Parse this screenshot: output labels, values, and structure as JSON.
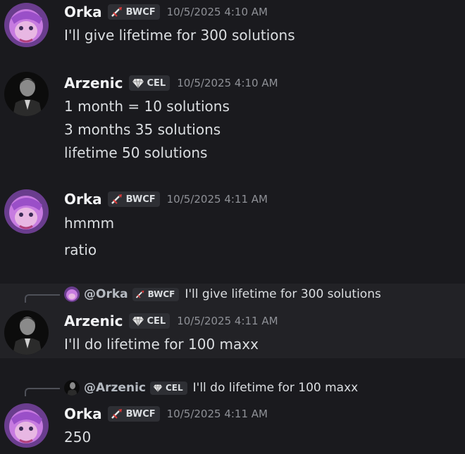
{
  "messages": [
    {
      "username": "Orka",
      "tag": "BWCF",
      "tag_icon": "sword-icon",
      "timestamp": "10/5/2025 4:10 AM",
      "lines": [
        "I'll give lifetime for 300 solutions"
      ]
    },
    {
      "username": "Arzenic",
      "tag": "CEL",
      "tag_icon": "diamond-icon",
      "timestamp": "10/5/2025 4:10 AM",
      "lines": [
        "1 month = 10 solutions",
        "3 months 35 solutions",
        "lifetime 50 solutions"
      ]
    },
    {
      "username": "Orka",
      "tag": "BWCF",
      "tag_icon": "sword-icon",
      "timestamp": "10/5/2025 4:11 AM",
      "lines": [
        "hmmm",
        "ratio"
      ]
    },
    {
      "reply": {
        "mention": "@Orka",
        "tag": "BWCF",
        "text": "I'll give lifetime for 300 solutions"
      },
      "username": "Arzenic",
      "tag": "CEL",
      "tag_icon": "diamond-icon",
      "timestamp": "10/5/2025 4:11 AM",
      "lines": [
        "I'll do lifetime for 100 maxx"
      ]
    },
    {
      "reply": {
        "mention": "@Arzenic",
        "tag": "CEL",
        "text": "I'll do lifetime for 100 maxx"
      },
      "username": "Orka",
      "tag": "BWCF",
      "tag_icon": "sword-icon",
      "timestamp": "10/5/2025 4:11 AM",
      "lines": [
        "250"
      ]
    }
  ],
  "colors": {
    "background": "#1a1a1e",
    "highlight": "#222226",
    "username": "#f2f3f5",
    "text": "#dbdee1",
    "timestamp": "#8f9197"
  }
}
